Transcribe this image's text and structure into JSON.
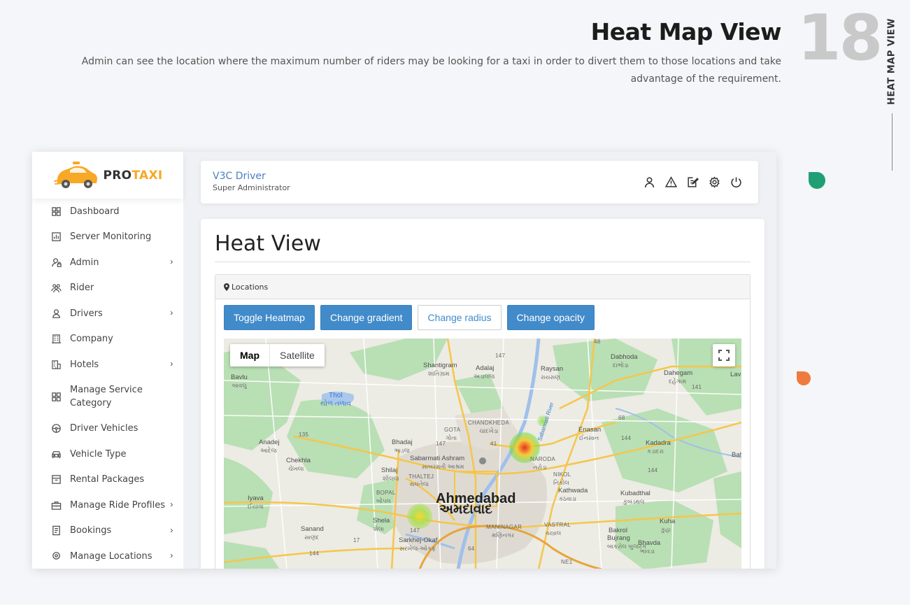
{
  "header": {
    "title": "Heat Map View",
    "description": "Admin can see the location where the maximum number of riders may be looking for a taxi in order to divert them to those locations and take advantage of the requirement.",
    "number": "18",
    "side_label": "HEAT MAP VIEW"
  },
  "brand": {
    "prefix": "PRO",
    "suffix": "TAXI"
  },
  "sidebar": {
    "items": [
      {
        "label": "Dashboard",
        "icon": "grid-icon",
        "chevron": ""
      },
      {
        "label": "Server Monitoring",
        "icon": "bar-chart-icon",
        "chevron": ""
      },
      {
        "label": "Admin",
        "icon": "user-lock-icon",
        "chevron": "›"
      },
      {
        "label": "Rider",
        "icon": "users-icon",
        "chevron": ""
      },
      {
        "label": "Drivers",
        "icon": "user-icon",
        "chevron": "›"
      },
      {
        "label": "Company",
        "icon": "building-icon",
        "chevron": ""
      },
      {
        "label": "Hotels",
        "icon": "hotel-icon",
        "chevron": "›"
      },
      {
        "label": "Manage Service Category",
        "icon": "grid-icon",
        "chevron": ""
      },
      {
        "label": "Driver Vehicles",
        "icon": "steering-wheel-icon",
        "chevron": ""
      },
      {
        "label": "Vehicle Type",
        "icon": "car-icon",
        "chevron": ""
      },
      {
        "label": "Rental Packages",
        "icon": "package-icon",
        "chevron": ""
      },
      {
        "label": "Manage Ride Profiles",
        "icon": "briefcase-icon",
        "chevron": "›"
      },
      {
        "label": "Bookings",
        "icon": "document-icon",
        "chevron": "›"
      },
      {
        "label": "Manage Locations",
        "icon": "location-icon",
        "chevron": "›"
      }
    ]
  },
  "topbar": {
    "user_name": "V3C Driver",
    "user_role": "Super Administrator",
    "icons": [
      "profile-icon",
      "alert-icon",
      "edit-icon",
      "settings-icon",
      "power-icon"
    ]
  },
  "main": {
    "title": "Heat View",
    "panel_title": "Locations",
    "buttons": {
      "toggle": "Toggle Heatmap",
      "gradient": "Change gradient",
      "radius": "Change radius",
      "opacity": "Change opacity"
    }
  },
  "map": {
    "type_map": "Map",
    "type_satellite": "Satellite",
    "city_name": "Ahmedabad",
    "city_name_local": "અમદાવાદ",
    "labels": {
      "shantigram": "Shantigram",
      "shantigram_local": "શાંતિગ્રામ",
      "adalaj": "Adalaj",
      "adalaj_local": "અડાલજ",
      "raysan": "Raysan",
      "raysan_local": "રાયસણ",
      "dabhoda": "Dabhoda",
      "dabhoda_local": "દાભોડા",
      "dahegam": "Dahegam",
      "dahegam_local": "દહેગામ",
      "lava": "Lav",
      "bavlu": "Bavlu",
      "bavlu_local": "બાવલુ",
      "thol": "Thol",
      "thol_local": "થોળ તળાવ",
      "gota": "GOTA",
      "gota_local": "ગોતા",
      "chandkheda": "CHANDKHEDA",
      "chandkheda_local": "ચાંદખેડા",
      "sabarmati_river": "Sabarmati River",
      "enasan": "Enasan",
      "enasan_local": "ઈનસાન",
      "anadej": "Anadej",
      "anadej_local": "આદેજ",
      "bhadaj": "Bhadaj",
      "bhadaj_local": "ભાડજ",
      "kadadra": "Kadadra",
      "kadadra_local": "કડાદરા",
      "chekhla": "Chekhla",
      "chekhla_local": "ચેખલા",
      "ashram": "Sabarmati Ashram",
      "ashram_local": "સાબરમતી આશ્રમ",
      "naroda": "NARODA",
      "naroda_local": "નરોડા",
      "bah": "Bah",
      "shilaj": "Shilaj",
      "shilaj_local": "શીલજ",
      "nikol": "NIKOL",
      "nikol_local": "નિકોલ",
      "thaltej": "THALTEJ",
      "thaltej_local": "થલતેજ",
      "bopal": "BOPAL",
      "bopal_local": "બોપલ",
      "kathwada": "Kathwada",
      "kathwada_local": "કઠવાડા",
      "kubadthal": "Kubadthal",
      "kubadthal_local": "કુબડથલ",
      "iyava": "Iyava",
      "iyava_local": "ઈયાવા",
      "shela": "Shela",
      "shela_local": "શેલા",
      "maninagar": "MANINAGAR",
      "maninagar_local": "મણિનગર",
      "vastral": "VASTRAL",
      "vastral_local": "વસ્ત્રાલ",
      "kuha": "Kuha",
      "kuha_local": "કુહા",
      "sanand": "Sanand",
      "sanand_local": "સાણંદ",
      "sarkhej": "Sarkhej-Okaf",
      "sarkhej_local": "સરખેજ-ઓકફ",
      "bakrol": "Bakrol",
      "bakrol_sub": "Bujrang",
      "bakrol_local": "બાકરોલ બુજરંગ",
      "bhavda": "Bhavda",
      "bhavda_local": "ભાવડા"
    },
    "shields": {
      "s48": "48",
      "s147a": "147",
      "s141": "141",
      "s135": "135",
      "s147b": "147",
      "s41": "41",
      "s68": "68",
      "s144a": "144",
      "s144b": "144",
      "s17": "17",
      "s147c": "147",
      "s64": "64",
      "s144c": "144",
      "ne1": "NE1"
    }
  }
}
